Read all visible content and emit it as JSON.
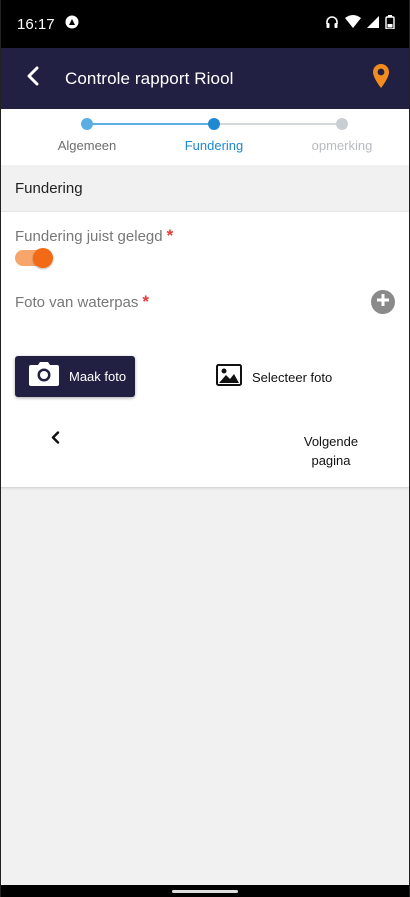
{
  "status_bar": {
    "time": "16:17",
    "icons": [
      "assistant-icon",
      "headphones-icon",
      "wifi-icon",
      "signal-icon",
      "battery-icon"
    ]
  },
  "app_bar": {
    "title": "Controle rapport Riool",
    "back_icon": "chevron-left-icon",
    "location_icon": "map-pin-icon",
    "accent_color": "#f28c1e",
    "background_color": "#212042"
  },
  "stepper": {
    "steps": [
      {
        "label": "Algemeen",
        "state": "done"
      },
      {
        "label": "Fundering",
        "state": "active"
      },
      {
        "label": "opmerking",
        "state": "upcoming"
      }
    ],
    "colors": {
      "done": "#5aaee4",
      "active": "#1e88d0",
      "upcoming": "#c9ced3"
    }
  },
  "section": {
    "title": "Fundering"
  },
  "form": {
    "fields": [
      {
        "label": "Fundering juist gelegd",
        "required": true,
        "type": "toggle",
        "value": true
      },
      {
        "label": "Foto van waterpas",
        "required": true,
        "type": "photo"
      }
    ],
    "required_marker": "*",
    "take_photo_label": "Maak foto",
    "select_photo_label": "Selecteer foto",
    "next_label_line1": "Volgende",
    "next_label_line2": "pagina",
    "toggle_color": "#f26a16"
  }
}
